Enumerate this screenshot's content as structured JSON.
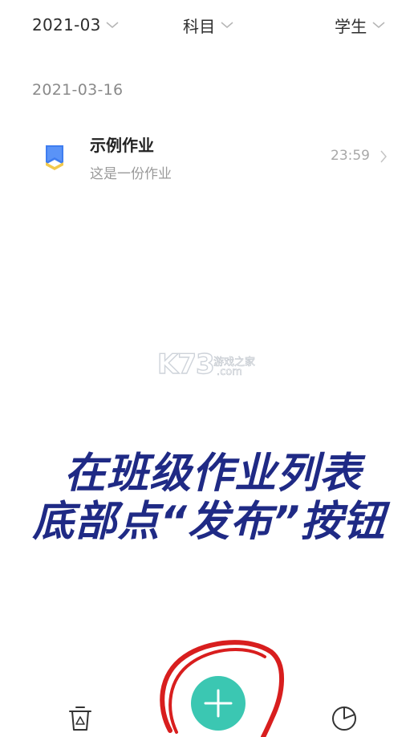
{
  "filters": {
    "month": "2021-03",
    "subject": "科目",
    "student": "学生"
  },
  "groups": [
    {
      "date": "2021-03-16",
      "items": [
        {
          "title": "示例作业",
          "description": "这是一份作业",
          "time": "23:59",
          "icon": "document-bookmark-icon"
        }
      ]
    }
  ],
  "watermark": {
    "brand": "K73",
    "subtitle": "游戏之家",
    "domain": ".com"
  },
  "caption": {
    "line1": "在班级作业列表",
    "line2": "底部点“发布”按钮"
  },
  "bottom_bar": {
    "left_icon": "trash-icon",
    "center_icon": "plus-icon",
    "right_icon": "pie-chart-icon"
  },
  "colors": {
    "accent": "#3bc7b2",
    "annotation": "#d81e1e",
    "caption": "#1f2a85",
    "icon_blue": "#3f7df0",
    "icon_yellow": "#f2c94c"
  }
}
